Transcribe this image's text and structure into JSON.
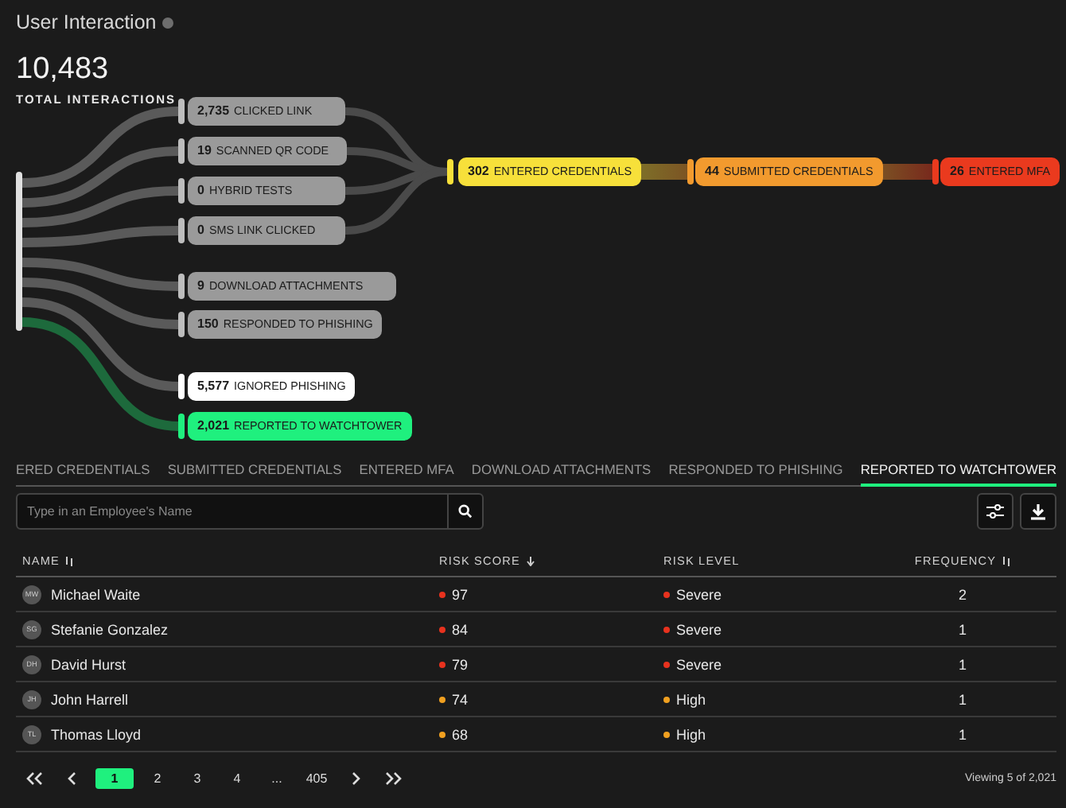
{
  "header": {
    "title": "User Interaction",
    "total": "10,483",
    "total_label": "TOTAL INTERACTIONS"
  },
  "flow": {
    "nodes": [
      {
        "text": "**2,735** CLICKED LINK",
        "color": "#9a9a9a",
        "kind": "entry"
      },
      {
        "text": "**19** SCANNED QR CODE",
        "color": "#9a9a9a",
        "kind": "entry"
      },
      {
        "text": "**0** HYBRID TESTS",
        "color": "#9a9a9a",
        "kind": "entry"
      },
      {
        "text": "**0** SMS LINK CLICKED",
        "color": "#9a9a9a",
        "kind": "entry"
      },
      {
        "text": "**9** DOWNLOAD ATTACHMENTS",
        "color": "#9a9a9a",
        "kind": "end"
      },
      {
        "text": "**150** RESPONDED TO PHISHING",
        "color": "#9a9a9a",
        "kind": "end"
      },
      {
        "text": "**5,577** IGNORED PHISHING",
        "color": "#ffffff",
        "kind": "end"
      },
      {
        "text": "**2,021** REPORTED TO WATCHTOWER",
        "color": "#1ff07e",
        "kind": "end"
      }
    ],
    "stages": [
      {
        "text": "**302** ENTERED CREDENTIALS",
        "color": "#f7e03a"
      },
      {
        "text": "**44** SUBMITTED CREDENTIALS",
        "color": "#f29a2e"
      },
      {
        "text": "**26** ENTERED MFA",
        "color": "#ea3a1e"
      }
    ]
  },
  "tabs": [
    {
      "label": "ERED CREDENTIALS",
      "selected": false
    },
    {
      "label": "SUBMITTED CREDENTIALS",
      "selected": false
    },
    {
      "label": "ENTERED MFA",
      "selected": false
    },
    {
      "label": "DOWNLOAD ATTACHMENTS",
      "selected": false
    },
    {
      "label": "RESPONDED TO PHISHING",
      "selected": false
    },
    {
      "label": "REPORTED TO WATCHTOWER",
      "selected": true
    }
  ],
  "search": {
    "placeholder": "Type in an Employee's Name"
  },
  "table": {
    "columns": [
      "NAME",
      "RISK SCORE",
      "RISK LEVEL",
      "FREQUENCY"
    ],
    "rows": [
      {
        "initials": "MW",
        "name": "Michael Waite",
        "score": "97",
        "level": "Severe",
        "frequency": "2",
        "color": "#e8321e"
      },
      {
        "initials": "SG",
        "name": "Stefanie Gonzalez",
        "score": "84",
        "level": "Severe",
        "frequency": "1",
        "color": "#e8321e"
      },
      {
        "initials": "DH",
        "name": "David Hurst",
        "score": "79",
        "level": "Severe",
        "frequency": "1",
        "color": "#e8321e"
      },
      {
        "initials": "JH",
        "name": "John Harrell",
        "score": "74",
        "level": "High",
        "frequency": "1",
        "color": "#f0a020"
      },
      {
        "initials": "TL",
        "name": "Thomas Lloyd",
        "score": "68",
        "level": "High",
        "frequency": "1",
        "color": "#f0a020"
      }
    ]
  },
  "pagination": {
    "pages": [
      {
        "label": "1",
        "selected": true
      },
      {
        "label": "2",
        "selected": false
      },
      {
        "label": "3",
        "selected": false
      },
      {
        "label": "4",
        "selected": false
      },
      {
        "label": "...",
        "selected": false
      },
      {
        "label": "405",
        "selected": false
      }
    ],
    "summary": "Viewing 5 of 2,021"
  }
}
